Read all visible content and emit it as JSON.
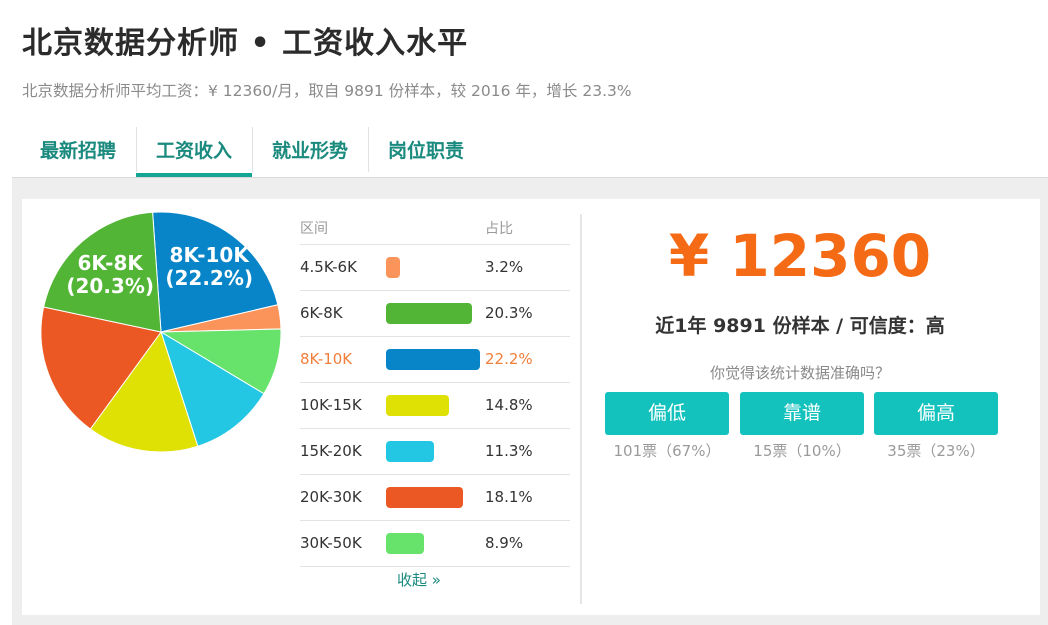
{
  "header": {
    "title": "北京数据分析师 • 工资收入水平",
    "subtitle": "北京数据分析师平均工资：¥ 12360/月，取自 9891 份样本，较 2016 年，增长 23.3%"
  },
  "tabs": [
    {
      "label": "最新招聘"
    },
    {
      "label": "工资收入"
    },
    {
      "label": "就业形势"
    },
    {
      "label": "岗位职责"
    }
  ],
  "active_tab": "工资收入",
  "table": {
    "col_range": "区间",
    "col_ratio": "占比",
    "collapse_label": "收起 »"
  },
  "chart_data": {
    "type": "pie",
    "categories": [
      "4.5K-6K",
      "6K-8K",
      "8K-10K",
      "10K-15K",
      "15K-20K",
      "20K-30K",
      "30K-50K"
    ],
    "values": [
      3.2,
      20.3,
      22.2,
      14.8,
      11.3,
      18.1,
      8.9
    ],
    "labels": [
      "3.2%",
      "20.3%",
      "22.2%",
      "14.8%",
      "11.3%",
      "18.1%",
      "8.9%"
    ],
    "colors": [
      "#fa945a",
      "#52b535",
      "#0785c8",
      "#dfe003",
      "#24c7e3",
      "#ec5823",
      "#67e36c"
    ],
    "highlighted": "8K-10K",
    "slice_labels": [
      {
        "line1": "6K-8K",
        "line2": "(20.3%)"
      },
      {
        "line1": "8K-10K",
        "line2": "(22.2%)"
      }
    ]
  },
  "summary": {
    "salary": "¥ 12360",
    "sample_text": "近1年 9891 份样本 / 可信度：高",
    "question": "你觉得该统计数据准确吗？"
  },
  "votes": [
    {
      "label": "偏低",
      "count": "101票（67%）"
    },
    {
      "label": "靠谱",
      "count": "15票（10%）"
    },
    {
      "label": "偏高",
      "count": "35票（23%）"
    }
  ],
  "colors": {
    "accent": "#13a595",
    "highlight": "#f07f3c",
    "salary": "#f56a15",
    "vote_button": "#13c2bd"
  }
}
